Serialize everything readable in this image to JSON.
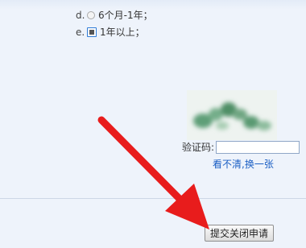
{
  "form": {
    "options": [
      {
        "letter": "d.",
        "label": "6个月-1年；",
        "selected": false
      },
      {
        "letter": "e.",
        "label": "1年以上；",
        "selected": true
      }
    ]
  },
  "captcha": {
    "label": "验证码:",
    "input_value": "",
    "refresh_link": "看不清,换一张"
  },
  "actions": {
    "submit_label": "提交关闭申请"
  },
  "colors": {
    "background": "#eef3fb",
    "link": "#1b5fc4",
    "arrow": "#e81c1c"
  }
}
